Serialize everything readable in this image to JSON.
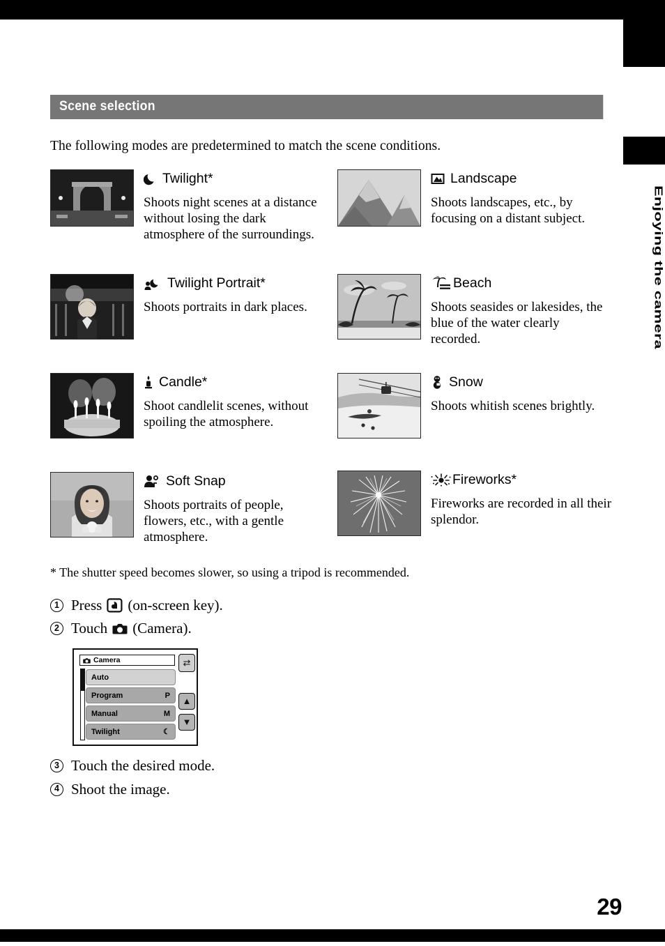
{
  "page": {
    "number": "29",
    "side_tab": "Enjoying the camera"
  },
  "section": {
    "header": "Scene selection",
    "intro": "The following modes are predetermined to match the scene conditions.",
    "footnote": "* The shutter speed becomes slower, so using a tripod is recommended."
  },
  "scenes": [
    {
      "title": "Twilight*",
      "icon": "crescent-moon-icon",
      "desc": "Shoots night scenes at a distance without losing the dark atmosphere of the surroundings.",
      "thumb": "night-arch-monument-photo"
    },
    {
      "title": "Landscape",
      "icon": "mountain-landscape-icon",
      "desc": "Shoots landscapes, etc., by focusing on a distant subject.",
      "thumb": "snowy-mountain-photo"
    },
    {
      "title": "Twilight Portrait*",
      "icon": "person-with-moon-icon",
      "desc": "Shoots portraits in dark places.",
      "thumb": "woman-at-night-waterfront-photo"
    },
    {
      "title": "Beach",
      "icon": "palm-tree-waves-icon",
      "desc": "Shoots seasides or lakesides, the blue of the water clearly recorded.",
      "thumb": "palm-beach-photo"
    },
    {
      "title": "Candle*",
      "icon": "candle-flame-icon",
      "desc": "Shoot candlelit scenes, without spoiling the atmosphere.",
      "thumb": "birthday-cake-candles-photo"
    },
    {
      "title": "Snow",
      "icon": "snowman-icon",
      "desc": "Shoots whitish scenes brightly.",
      "thumb": "ski-slope-gondola-photo"
    },
    {
      "title": "Soft Snap",
      "icon": "person-portrait-icon",
      "desc": "Shoots portraits of people, flowers, etc., with a gentle atmosphere.",
      "thumb": "smiling-woman-with-flowers-photo"
    },
    {
      "title": "Fireworks*",
      "icon": "fireworks-burst-icon",
      "desc": "Fireworks are recorded in all their splendor.",
      "thumb": "fireworks-night-photo"
    }
  ],
  "steps": [
    {
      "num": "1",
      "before": "Press",
      "icon": "on-screen-key-icon",
      "after": "(on-screen key)."
    },
    {
      "num": "2",
      "before": "Touch",
      "icon": "camera-icon",
      "after": "(Camera)."
    },
    {
      "num": "3",
      "before": "Touch the desired mode.",
      "icon": "",
      "after": ""
    },
    {
      "num": "4",
      "before": "Shoot the image.",
      "icon": "",
      "after": ""
    }
  ],
  "camera_menu": {
    "title": "Camera",
    "title_icon": "camera-icon",
    "items": [
      {
        "label": "Auto",
        "value": "",
        "selected": true
      },
      {
        "label": "Program",
        "value": "P",
        "selected": false
      },
      {
        "label": "Manual",
        "value": "M",
        "selected": false
      },
      {
        "label": "Twilight",
        "value": "☾",
        "selected": false
      }
    ],
    "buttons": [
      {
        "name": "back-button",
        "glyph": "⇄"
      },
      {
        "name": "scroll-up-button",
        "glyph": "▲"
      },
      {
        "name": "scroll-down-button",
        "glyph": "▼"
      }
    ]
  },
  "colors": {
    "header_bg": "#767676",
    "bar_black": "#000000",
    "menu_item_selected": "#d2d2d2",
    "menu_item": "#a8a8a8"
  }
}
